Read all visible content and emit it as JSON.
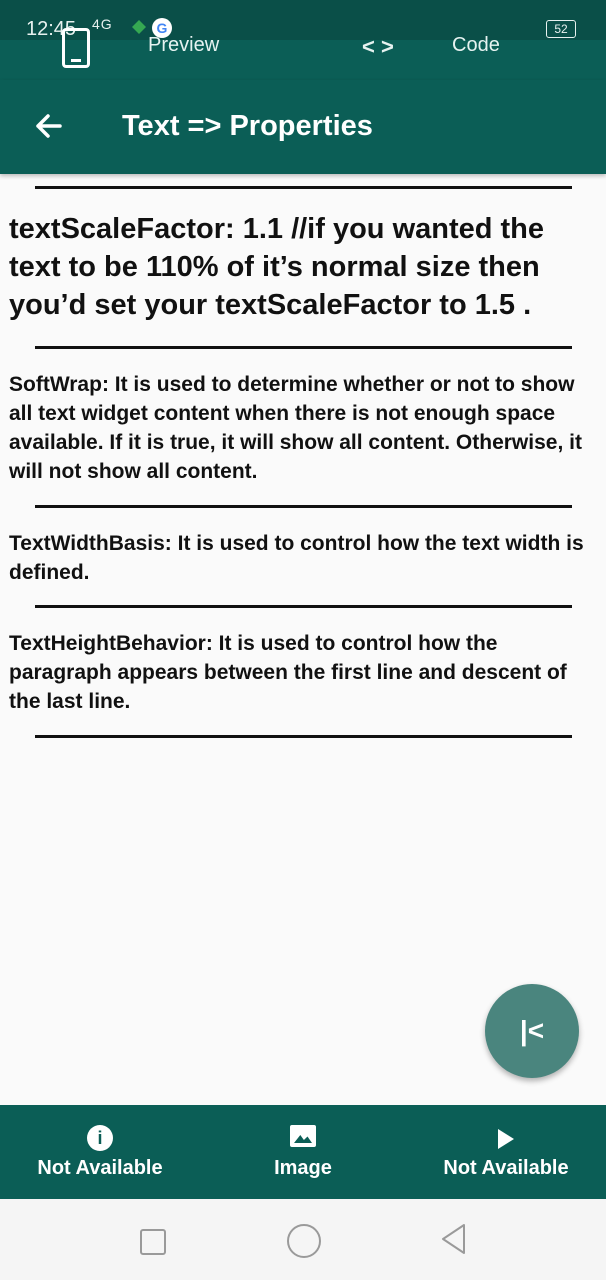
{
  "status_bar": {
    "time": "12:45",
    "network": "4G",
    "battery": "52"
  },
  "tabs": {
    "preview_label": "Preview",
    "code_icon": "< >",
    "code_label": "Code"
  },
  "app_bar": {
    "title": "Text => Properties",
    "back_icon": "arrow-left-icon"
  },
  "content": {
    "paragraphs": [
      "textScaleFactor: 1.1 //if you wanted the text to be 110% of it’s normal size then you’d set your textScaleFactor to 1.5 .",
      "SoftWrap: It is used to determine whether or not to show all text widget content when there is not enough space available. If it is true, it will show all content. Otherwise, it will not show all content.",
      "TextWidthBasis: It is used to control how the text width is defined.",
      "TextHeightBehavior: It is used to control how the paragraph appears between the first line and descent of the last line."
    ]
  },
  "fab": {
    "label": "|<"
  },
  "bottom_nav": {
    "items": [
      {
        "label": "Not Available",
        "icon": "info-icon"
      },
      {
        "label": "Image",
        "icon": "image-icon"
      },
      {
        "label": "Not Available",
        "icon": "play-icon"
      }
    ]
  },
  "colors": {
    "primary": "#0b5e56",
    "fab": "#4a857e",
    "background": "#fafafa"
  }
}
